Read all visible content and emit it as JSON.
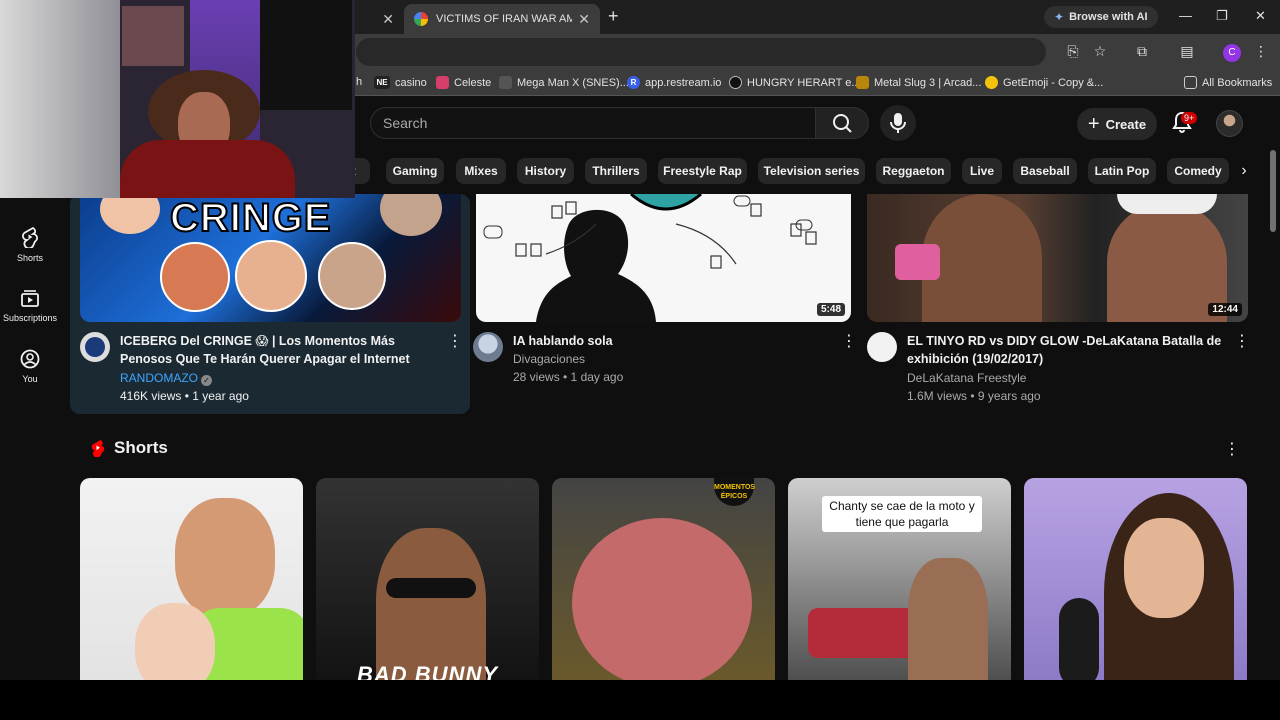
{
  "browser": {
    "tabs": [
      {
        "label": "",
        "active": false
      },
      {
        "label": "VICTIMS OF IRAN WAR AMERIC",
        "active": true
      }
    ],
    "new_tab": "+",
    "ai_button": "Browse with AI",
    "profile_initial": "C",
    "bookmarks": [
      {
        "label": "h",
        "icon": ""
      },
      {
        "label": "casino",
        "icon": "NE"
      },
      {
        "label": "Celeste",
        "icon": "celeste-icon"
      },
      {
        "label": "Mega Man X (SNES)...",
        "icon": "gamepad-icon"
      },
      {
        "label": "app.restream.io",
        "icon": "R"
      },
      {
        "label": "HUNGRY HERART e...",
        "icon": "disc-icon"
      },
      {
        "label": "Metal Slug 3 | Arcad...",
        "icon": "metal-slug-icon"
      },
      {
        "label": "GetEmoji - Copy &...",
        "icon": "emoji-icon"
      }
    ],
    "all_bookmarks": "All Bookmarks"
  },
  "youtube": {
    "search_placeholder": "Search",
    "create_label": "Create",
    "notification_count": "9+",
    "chips": [
      "nt",
      "Gaming",
      "Mixes",
      "History",
      "Thrillers",
      "Freestyle Rap",
      "Television series",
      "Reggaeton",
      "Live",
      "Baseball",
      "Latin Pop",
      "Comedy"
    ],
    "sidebar": [
      {
        "label": "Shorts",
        "icon": "shorts-icon"
      },
      {
        "label": "Subscriptions",
        "icon": "subscriptions-icon"
      },
      {
        "label": "You",
        "icon": "you-icon"
      }
    ],
    "videos": [
      {
        "title_line1": "ICEBERG Del CRINGE 😱 | Los Momentos Más",
        "title_line2": "Penosos Que Te Harán Querer Apagar el Internet",
        "channel": "RANDOMAZO",
        "meta": "416K views • 1 year ago",
        "thumb_text": "CRINGE",
        "duration": ""
      },
      {
        "title_line1": "IA hablando sola",
        "title_line2": "",
        "channel": "Divagaciones",
        "meta": "28 views • 1 day ago",
        "thumb_text": "",
        "duration": "5:48"
      },
      {
        "title_line1": "EL TINYO RD vs DIDY GLOW -DeLaKatana Batalla de",
        "title_line2": "exhibición (19/02/2017)",
        "channel": "DeLaKatana Freestyle",
        "meta": "1.6M views • 9 years ago",
        "thumb_text": "",
        "duration": "12:44"
      }
    ],
    "shorts_title": "Shorts",
    "shorts": [
      {
        "caption": "",
        "badge": "",
        "overlay_text": ""
      },
      {
        "caption": "",
        "badge": "",
        "overlay_text": "BAD BUNNY"
      },
      {
        "caption": "",
        "badge": "MOMENTOS ÉPICOS",
        "overlay_text": ""
      },
      {
        "caption": "Chanty se cae de la moto y tiene que pagarla",
        "badge": "",
        "overlay_text": ""
      },
      {
        "caption": "",
        "badge": "",
        "overlay_text": ""
      }
    ]
  },
  "colors": {
    "background": "#0f0f0f",
    "chip": "#272727",
    "hover_card": "#1b2a32",
    "youtube_red": "#ff0000",
    "notification_badge": "#cc0000"
  }
}
